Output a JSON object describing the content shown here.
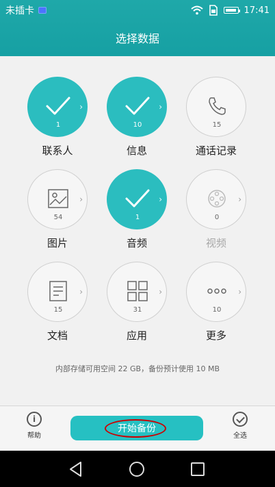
{
  "status_bar": {
    "carrier": "未插卡",
    "time": "17:41"
  },
  "header": {
    "title": "选择数据"
  },
  "items": [
    {
      "label": "联系人",
      "count": "1",
      "selected": true,
      "enabled": true,
      "icon": "check-icon"
    },
    {
      "label": "信息",
      "count": "10",
      "selected": true,
      "enabled": true,
      "icon": "check-icon"
    },
    {
      "label": "通话记录",
      "count": "15",
      "selected": false,
      "enabled": true,
      "icon": "phone-icon"
    },
    {
      "label": "图片",
      "count": "54",
      "selected": false,
      "enabled": true,
      "icon": "image-icon"
    },
    {
      "label": "音频",
      "count": "1",
      "selected": true,
      "enabled": true,
      "icon": "check-icon"
    },
    {
      "label": "视频",
      "count": "0",
      "selected": false,
      "enabled": false,
      "icon": "video-reel-icon"
    },
    {
      "label": "文档",
      "count": "15",
      "selected": false,
      "enabled": true,
      "icon": "document-icon"
    },
    {
      "label": "应用",
      "count": "31",
      "selected": false,
      "enabled": true,
      "icon": "apps-grid-icon"
    },
    {
      "label": "更多",
      "count": "10",
      "selected": false,
      "enabled": true,
      "icon": "more-dots-icon"
    }
  ],
  "storage_info": "内部存储可用空间 22 GB，备份预计使用 10 MB",
  "bottom_bar": {
    "help_label": "帮助",
    "start_label": "开始备份",
    "select_all_label": "全选"
  },
  "colors": {
    "accent": "#2bbdbf",
    "header_bg": "#1fa8a9",
    "annotation": "#cc0000"
  }
}
